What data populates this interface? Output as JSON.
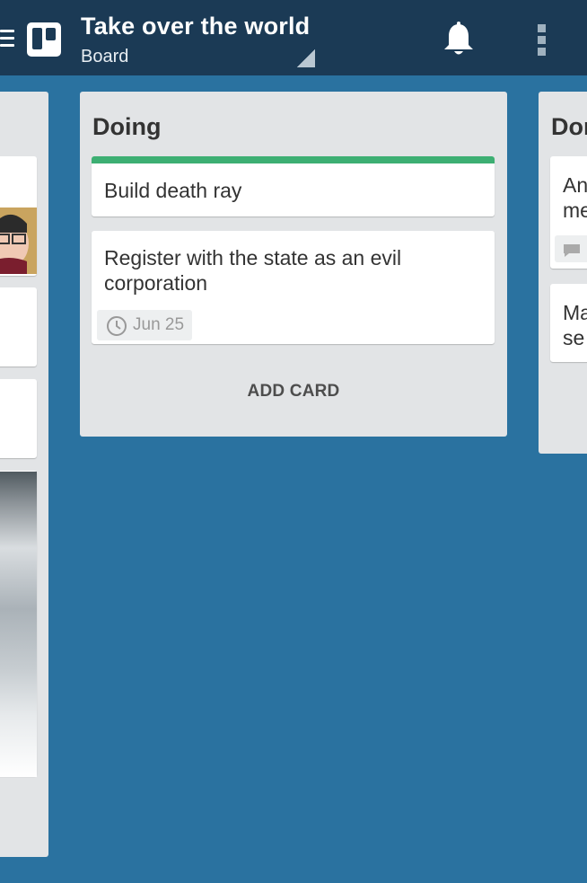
{
  "header": {
    "board_title": "Take over the world",
    "board_subtitle": "Board",
    "icons": [
      "menu-icon",
      "trello-logo-icon",
      "dropdown-icon",
      "bell-icon",
      "overflow-menu-icon"
    ],
    "bar_color": "#1b3a55"
  },
  "lists": {
    "doing": {
      "title": "Doing",
      "cards": [
        {
          "text": "Build death ray",
          "label_color": "#3daf73"
        },
        {
          "text": "Register with the state as an evil corporation",
          "due": "Jun 25"
        }
      ],
      "add_card_label": "ADD CARD"
    },
    "done": {
      "title": "Don",
      "cards": [
        {
          "text": "An\nme"
        },
        {
          "text": "Ma\nse"
        }
      ]
    }
  },
  "colors": {
    "board_background": "#2a72a0",
    "list_background": "#e2e4e6",
    "label_green": "#3daf73"
  }
}
